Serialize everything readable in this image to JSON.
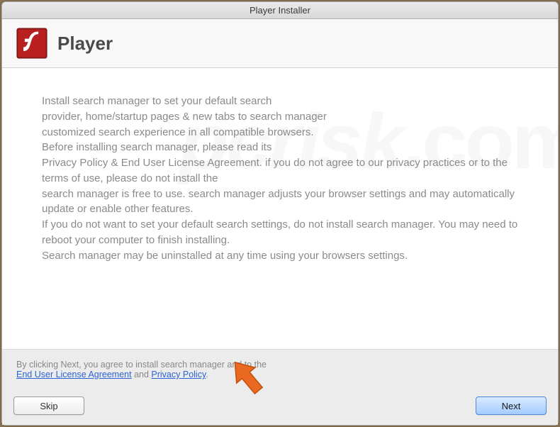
{
  "window": {
    "title": "Player Installer"
  },
  "header": {
    "appTitle": "Player"
  },
  "body": {
    "text": "Install search manager to set your default search\nprovider, home/startup pages & new tabs to search manager\ncustomized search experience in all compatible browsers.\nBefore installing search manager, please read its\nPrivacy Policy & End User License Agreement. if you do not agree to our privacy practices or to the terms of use, please do not install the\nsearch manager is free to use. search manager adjusts your browser settings and may automatically update or enable other features.\nIf you do not want to set your default search settings, do not install search manager. You may need to reboot your computer to finish installing.\nSearch manager may be uninstalled at any time using your browsers settings."
  },
  "footer": {
    "preText": "By clicking Next, you agree to install search manager and to the",
    "eulaLink": "End User License Agreement",
    "midText": " and ",
    "privacyLink": "Privacy Policy",
    "endText": "."
  },
  "buttons": {
    "skip": "Skip",
    "next": "Next"
  },
  "watermark": {
    "text": "pcrisk",
    "suffix": ".com"
  }
}
